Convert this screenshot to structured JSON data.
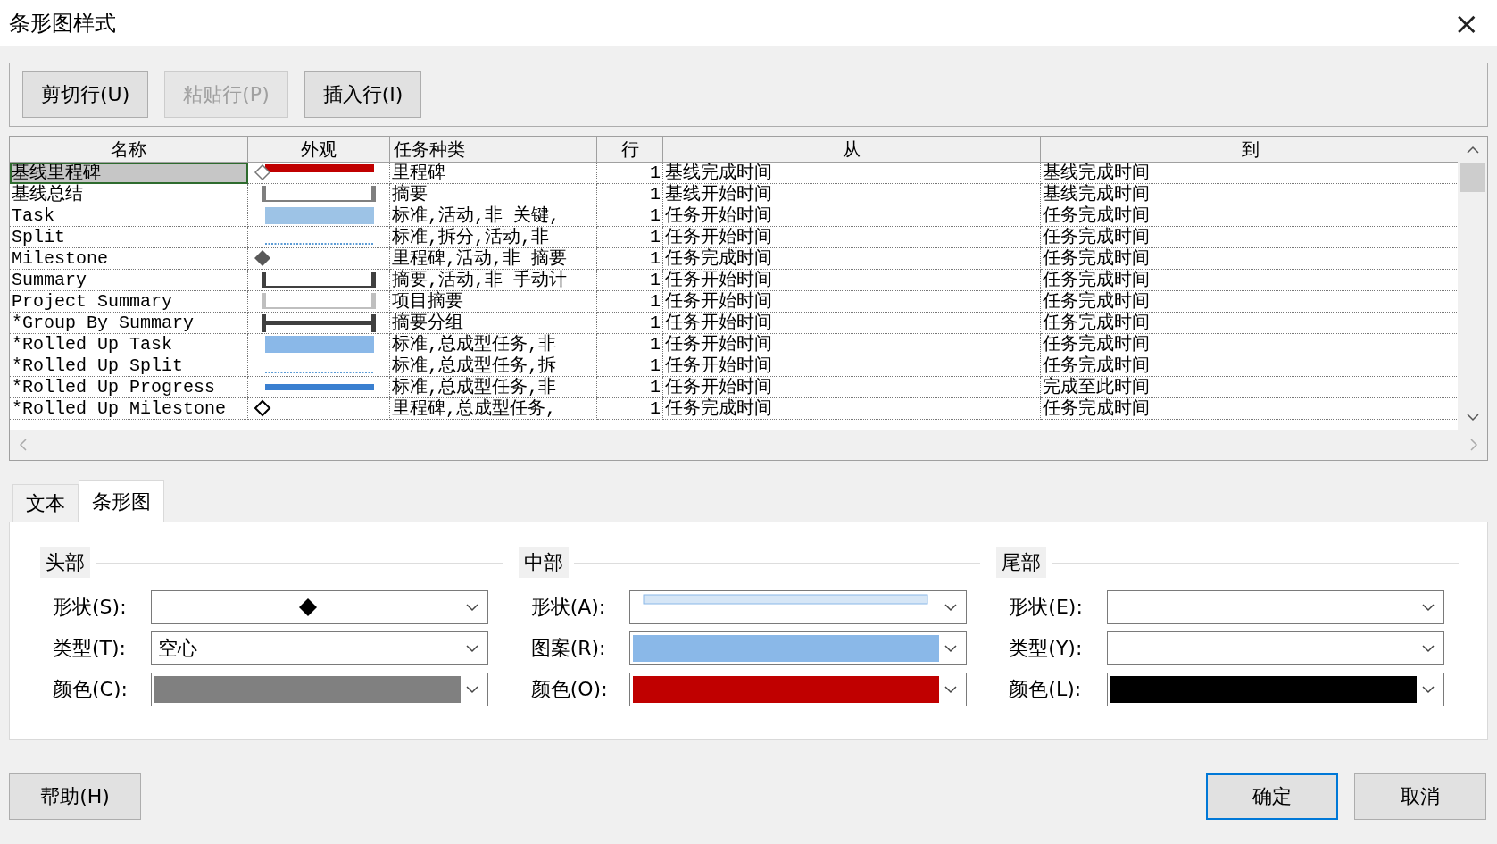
{
  "window": {
    "title": "条形图样式",
    "close": "×"
  },
  "toolbar": [
    {
      "label": "剪切行(U)",
      "disabled": false
    },
    {
      "label": "粘贴行(P)",
      "disabled": true
    },
    {
      "label": "插入行(I)",
      "disabled": false
    }
  ],
  "table": {
    "columns": [
      "名称",
      "外观",
      "任务种类",
      "行",
      "从",
      "到"
    ],
    "rows": [
      {
        "name": "基线里程碑",
        "appearance": {
          "kind": "milestone-bar",
          "color": "#c00000"
        },
        "task_kind": "里程碑",
        "row": "1",
        "from": "基线完成时间",
        "to": "基线完成时间",
        "selected": true
      },
      {
        "name": "基线总结",
        "appearance": {
          "kind": "bracket",
          "color": "#7f7f7f"
        },
        "task_kind": "摘要",
        "row": "1",
        "from": "基线开始时间",
        "to": "基线完成时间",
        "selected": false
      },
      {
        "name": "Task",
        "appearance": {
          "kind": "bar",
          "color": "#9dc3e6"
        },
        "task_kind": "标准,活动,非 关键,",
        "row": "1",
        "from": "任务开始时间",
        "to": "任务完成时间",
        "selected": false
      },
      {
        "name": "Split",
        "appearance": {
          "kind": "dotted",
          "color": "#5b9bd5"
        },
        "task_kind": "标准,拆分,活动,非",
        "row": "1",
        "from": "任务开始时间",
        "to": "任务完成时间",
        "selected": false
      },
      {
        "name": "Milestone",
        "appearance": {
          "kind": "diamond",
          "color": "#595959"
        },
        "task_kind": "里程碑,活动,非 摘要",
        "row": "1",
        "from": "任务完成时间",
        "to": "任务完成时间",
        "selected": false
      },
      {
        "name": "Summary",
        "appearance": {
          "kind": "bracket",
          "color": "#404040"
        },
        "task_kind": "摘要,活动,非 手动计",
        "row": "1",
        "from": "任务开始时间",
        "to": "任务完成时间",
        "selected": false
      },
      {
        "name": "Project Summary",
        "appearance": {
          "kind": "bracket",
          "color": "#bfbfbf"
        },
        "task_kind": "项目摘要",
        "row": "1",
        "from": "任务开始时间",
        "to": "任务完成时间",
        "selected": false
      },
      {
        "name": "*Group By Summary",
        "appearance": {
          "kind": "heavy-bracket",
          "color": "#404040"
        },
        "task_kind": "摘要分组",
        "row": "1",
        "from": "任务开始时间",
        "to": "任务完成时间",
        "selected": false
      },
      {
        "name": "*Rolled Up Task",
        "appearance": {
          "kind": "bar",
          "color": "#8ab8e8"
        },
        "task_kind": "标准,总成型任务,非",
        "row": "1",
        "from": "任务开始时间",
        "to": "任务完成时间",
        "selected": false
      },
      {
        "name": "*Rolled Up Split",
        "appearance": {
          "kind": "dotted",
          "color": "#5b9bd5"
        },
        "task_kind": "标准,总成型任务,拆",
        "row": "1",
        "from": "任务开始时间",
        "to": "任务完成时间",
        "selected": false
      },
      {
        "name": "*Rolled Up Progress",
        "appearance": {
          "kind": "thin-bar",
          "color": "#3a7fd0"
        },
        "task_kind": "标准,总成型任务,非",
        "row": "1",
        "from": "任务开始时间",
        "to": "完成至此时间",
        "selected": false
      },
      {
        "name": "*Rolled Up Milestone",
        "appearance": {
          "kind": "hollow-diamond",
          "color": "#000000"
        },
        "task_kind": "里程碑,总成型任务,",
        "row": "1",
        "from": "任务完成时间",
        "to": "任务完成时间",
        "selected": false
      }
    ]
  },
  "tabs": [
    {
      "label": "文本",
      "selected": false
    },
    {
      "label": "条形图",
      "selected": true
    }
  ],
  "groups": [
    {
      "title": "头部",
      "fields": [
        {
          "label": "形状(S):",
          "kind": "shape",
          "icon": {
            "kind": "diamond"
          }
        },
        {
          "label": "类型(T):",
          "kind": "text",
          "value": "空心"
        },
        {
          "label": "颜色(C):",
          "kind": "color",
          "color": "#808080"
        }
      ]
    },
    {
      "title": "中部",
      "fields": [
        {
          "label": "形状(A):",
          "kind": "shape",
          "icon": {
            "kind": "thin-bar"
          }
        },
        {
          "label": "图案(R):",
          "kind": "color",
          "color": "#8ab8e8"
        },
        {
          "label": "颜色(O):",
          "kind": "color",
          "color": "#c00000"
        }
      ]
    },
    {
      "title": "尾部",
      "fields": [
        {
          "label": "形状(E):",
          "kind": "shape"
        },
        {
          "label": "类型(Y):",
          "kind": "text"
        },
        {
          "label": "颜色(L):",
          "kind": "color",
          "color": "#000000"
        }
      ]
    }
  ],
  "footer": {
    "help": "帮助(H)",
    "ok": "确定",
    "cancel": "取消"
  }
}
